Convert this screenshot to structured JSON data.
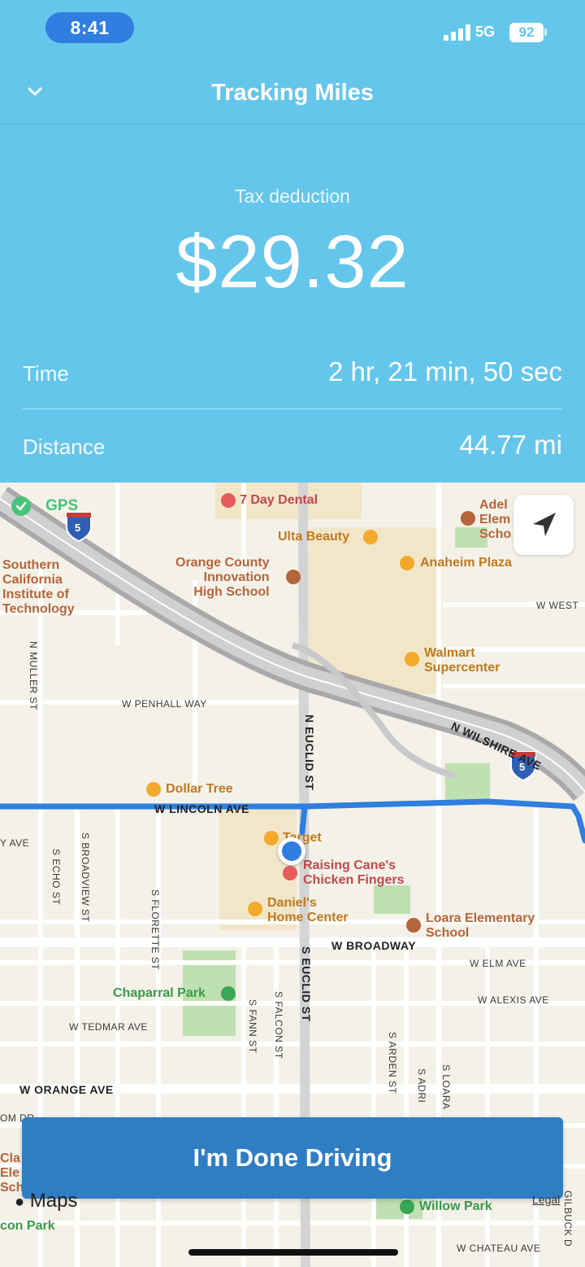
{
  "status": {
    "time": "8:41",
    "network": "5G",
    "battery": "92"
  },
  "nav": {
    "title": "Tracking Miles"
  },
  "summary": {
    "deduction_label": "Tax deduction",
    "deduction_value": "$29.32",
    "time_label": "Time",
    "time_value": "2 hr, 21 min, 50 sec",
    "distance_label": "Distance",
    "distance_value": "44.77 mi"
  },
  "map": {
    "gps_label": "GPS",
    "pois": {
      "dental": "7 Day Dental",
      "ulta": "Ulta Beauty",
      "anaheim_plaza": "Anaheim Plaza",
      "orange_county": "Orange County\nInnovation\nHigh School",
      "southern_california": "Southern\nCalifornia\nInstitute of\nTechnology",
      "walmart": "Walmart\nSupercenter",
      "dollar_tree": "Dollar Tree",
      "target": "Target",
      "raising_canes": "Raising Cane's\nChicken Fingers",
      "daniels": "Daniel's\nHome Center",
      "loara": "Loara Elementary\nSchool",
      "adel": "Adel\nElem\nScho",
      "chaparral_park": "Chaparral Park",
      "willow_park": "Willow Park",
      "clar": "Cla\nEle\nSch",
      "con_park": "con Park"
    },
    "streets": {
      "w_west": "W WEST",
      "w_penhall": "W PENHALL WAY",
      "n_wilshire": "N WILSHIRE AVE",
      "n_euclid": "N EUCLID ST",
      "w_lincoln": "W LINCOLN AVE",
      "y_ave": "Y AVE",
      "s_echo": "S ECHO ST",
      "s_broadview": "S BROADVIEW ST",
      "s_florette": "S FLORETTE ST",
      "s_euclid": "S EUCLID ST",
      "w_broadway": "W BROADWAY",
      "w_elm": "W ELM AVE",
      "w_alexis": "W ALEXIS AVE",
      "w_tedmar": "W TEDMAR AVE",
      "s_fann": "S FANN ST",
      "s_falcon": "S FALCON ST",
      "s_arden": "S ARDEN ST",
      "s_adri": "S ADRI",
      "s_loara": "S LOARA",
      "w_orange": "W ORANGE AVE",
      "om_dr": "OM DR",
      "w_chateau": "W CHATEAU AVE",
      "n_muller": "N MULLER ST",
      "gilbuck": "GILBUCK D"
    },
    "freeway_shield": "5",
    "maps_credit": "Maps",
    "legal": "Legal"
  },
  "action": {
    "done_label": "I'm Done Driving"
  },
  "colors": {
    "header": "#64c6ea",
    "route": "#2f7ee0",
    "button": "#2f7ec4"
  }
}
